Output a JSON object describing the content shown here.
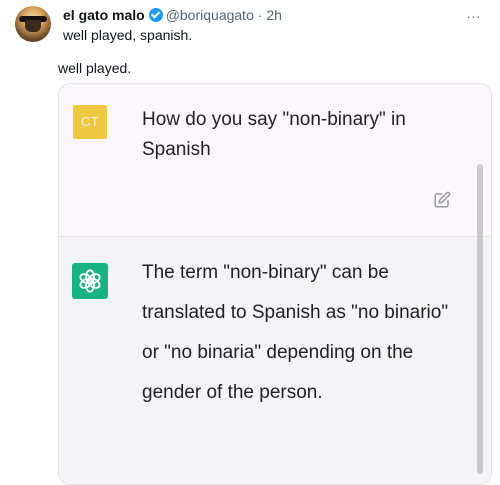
{
  "tweet": {
    "display_name": "el gato malo",
    "handle": "@boriquagato",
    "separator": "·",
    "time": "2h",
    "text": "well played, spanish.",
    "more_label": "..."
  },
  "caption": "well played.",
  "chat": {
    "user": {
      "avatar_initials": "CT",
      "message": "How do you say \"non-binary\" in Spanish"
    },
    "assistant": {
      "message": "The term \"non-binary\" can be translated to Spanish as \"no binario\" or \"no binaria\" depending on the gender of the person."
    }
  },
  "colors": {
    "verified": "#1d9bf0",
    "user_avatar": "#ecc940",
    "assistant_avatar": "#19b383"
  },
  "icons": {
    "verified": "verified-badge-icon",
    "more": "more-options-icon",
    "edit": "edit-icon",
    "assistant": "openai-logo-icon"
  }
}
